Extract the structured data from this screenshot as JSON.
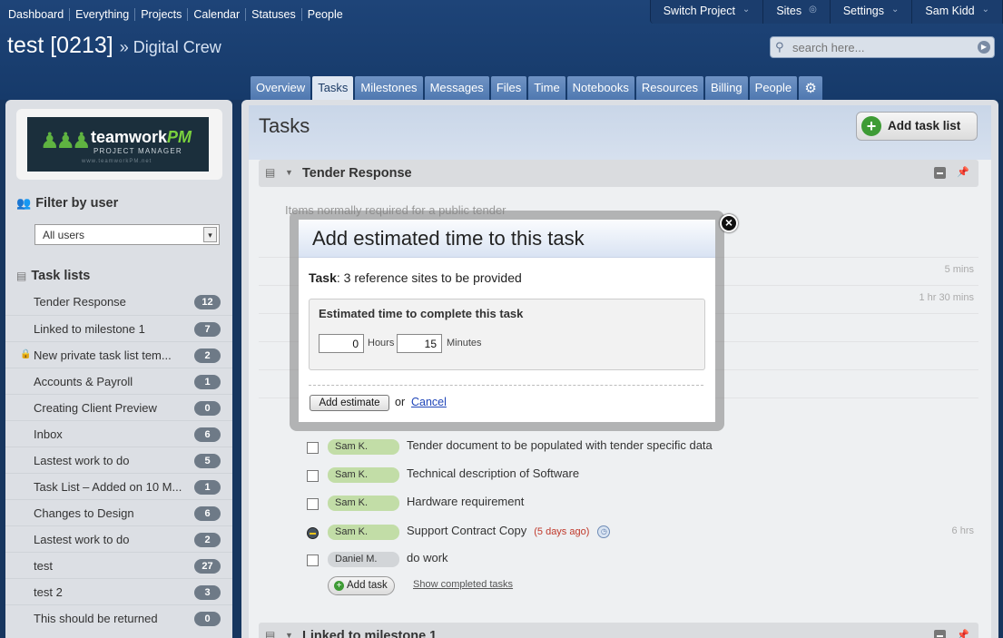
{
  "topnav": [
    "Dashboard",
    "Everything",
    "Projects",
    "Calendar",
    "Statuses",
    "People"
  ],
  "topright": [
    {
      "label": "Switch Project",
      "icon": "chevron-down"
    },
    {
      "label": "Sites",
      "icon": "globe"
    },
    {
      "label": "Settings",
      "icon": "chevron-down"
    },
    {
      "label": "Sam Kidd",
      "icon": "chevron-down"
    }
  ],
  "project": {
    "title": "test [0213]",
    "company": "» Digital Crew"
  },
  "search": {
    "placeholder": "search here..."
  },
  "tabs": [
    "Overview",
    "Tasks",
    "Milestones",
    "Messages",
    "Files",
    "Time",
    "Notebooks",
    "Resources",
    "Billing",
    "People"
  ],
  "logo": {
    "brand": "teamwork",
    "brand_suffix": "PM",
    "tagline": "PROJECT MANAGER",
    "url": "www.teamworkPM.net"
  },
  "sidebar": {
    "filter_title": "Filter by user",
    "user_select": "All users",
    "tasklists_title": "Task lists",
    "items": [
      {
        "label": "Tender Response",
        "count": "12"
      },
      {
        "label": "Linked to milestone 1",
        "count": "7"
      },
      {
        "label": "New private task list tem...",
        "count": "2"
      },
      {
        "label": "Accounts & Payroll",
        "count": "1"
      },
      {
        "label": "Creating Client Preview",
        "count": "0"
      },
      {
        "label": "Inbox",
        "count": "6"
      },
      {
        "label": "Lastest work to do",
        "count": "5"
      },
      {
        "label": "Task List – Added on 10 M...",
        "count": "1"
      },
      {
        "label": "Changes to Design",
        "count": "6"
      },
      {
        "label": "Lastest work to do",
        "count": "2"
      },
      {
        "label": "test",
        "count": "27"
      },
      {
        "label": "test 2",
        "count": "3"
      },
      {
        "label": "This should be returned",
        "count": "0"
      }
    ]
  },
  "main": {
    "title": "Tasks",
    "add_list": "Add task list",
    "group1": "Tender Response",
    "group1_desc": "Items normally required for a public tender",
    "dim_times": [
      "5 mins",
      "1 hr 30 mins"
    ],
    "tasks": [
      {
        "who": "Sam K.",
        "name": "Tender document to be populated with tender specific data"
      },
      {
        "who": "Sam K.",
        "name": "Technical description of Software"
      },
      {
        "who": "Sam K.",
        "name": "Hardware requirement"
      },
      {
        "who": "Sam K.",
        "name": "Support Contract Copy",
        "late": "(5 days ago)",
        "time": "6 hrs"
      },
      {
        "who": "Daniel M.",
        "name": "do work"
      }
    ],
    "add_task": "Add task",
    "show_completed": "Show completed tasks",
    "group2": "Linked to milestone 1"
  },
  "modal": {
    "title": "Add estimated time to this task",
    "task_label": "Task",
    "task_name": ": 3 reference sites to be provided",
    "box_label": "Estimated time to complete this task",
    "hours_value": "0",
    "hours_unit": "Hours",
    "minutes_value": "15",
    "minutes_unit": "Minutes",
    "add_button": "Add estimate",
    "or": "or",
    "cancel": "Cancel"
  }
}
